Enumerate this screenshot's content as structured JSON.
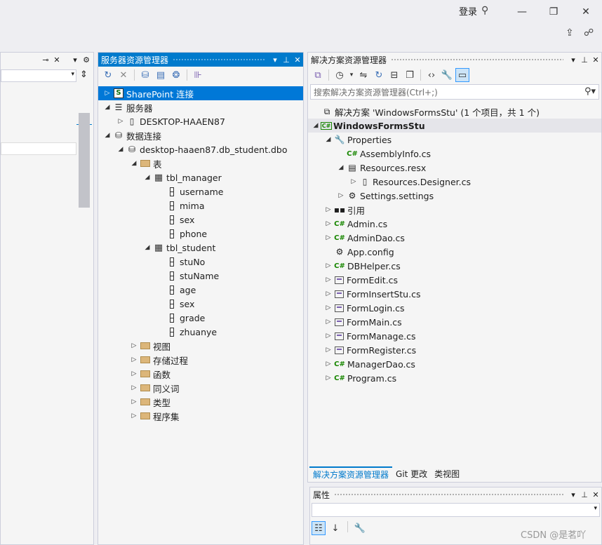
{
  "titlebar": {
    "login": "登录"
  },
  "server_explorer": {
    "title": "服务器资源管理器",
    "tree": [
      {
        "label": "SharePoint 连接",
        "indent": 0,
        "arrow": "▷",
        "icon": "sharepoint-icon",
        "glyph": "S",
        "selected": true
      },
      {
        "label": "服务器",
        "indent": 0,
        "arrow": "◢",
        "icon": "servers-icon",
        "glyph": "☰"
      },
      {
        "label": "DESKTOP-HAAEN87",
        "indent": 1,
        "arrow": "▷",
        "icon": "server-icon",
        "glyph": "▯"
      },
      {
        "label": "数据连接",
        "indent": 0,
        "arrow": "◢",
        "icon": "data-connections-icon",
        "glyph": "⛁"
      },
      {
        "label": "desktop-haaen87.db_student.dbo",
        "indent": 1,
        "arrow": "◢",
        "icon": "database-icon",
        "glyph": "⛁"
      },
      {
        "label": "表",
        "indent": 2,
        "arrow": "◢",
        "icon": "folder-icon",
        "glyph": ""
      },
      {
        "label": "tbl_manager",
        "indent": 3,
        "arrow": "◢",
        "icon": "table-icon",
        "glyph": "▦"
      },
      {
        "label": "username",
        "indent": 4,
        "arrow": "",
        "icon": "column-icon",
        "glyph": ""
      },
      {
        "label": "mima",
        "indent": 4,
        "arrow": "",
        "icon": "column-icon",
        "glyph": ""
      },
      {
        "label": "sex",
        "indent": 4,
        "arrow": "",
        "icon": "column-icon",
        "glyph": ""
      },
      {
        "label": "phone",
        "indent": 4,
        "arrow": "",
        "icon": "column-icon",
        "glyph": ""
      },
      {
        "label": "tbl_student",
        "indent": 3,
        "arrow": "◢",
        "icon": "table-icon",
        "glyph": "▦"
      },
      {
        "label": "stuNo",
        "indent": 4,
        "arrow": "",
        "icon": "column-icon",
        "glyph": ""
      },
      {
        "label": "stuName",
        "indent": 4,
        "arrow": "",
        "icon": "column-icon",
        "glyph": ""
      },
      {
        "label": "age",
        "indent": 4,
        "arrow": "",
        "icon": "column-icon",
        "glyph": ""
      },
      {
        "label": "sex",
        "indent": 4,
        "arrow": "",
        "icon": "column-icon",
        "glyph": ""
      },
      {
        "label": "grade",
        "indent": 4,
        "arrow": "",
        "icon": "column-icon",
        "glyph": ""
      },
      {
        "label": "zhuanye",
        "indent": 4,
        "arrow": "",
        "icon": "column-icon",
        "glyph": ""
      },
      {
        "label": "视图",
        "indent": 2,
        "arrow": "▷",
        "icon": "folder-icon",
        "glyph": ""
      },
      {
        "label": "存储过程",
        "indent": 2,
        "arrow": "▷",
        "icon": "folder-icon",
        "glyph": ""
      },
      {
        "label": "函数",
        "indent": 2,
        "arrow": "▷",
        "icon": "folder-icon",
        "glyph": ""
      },
      {
        "label": "同义词",
        "indent": 2,
        "arrow": "▷",
        "icon": "folder-icon",
        "glyph": ""
      },
      {
        "label": "类型",
        "indent": 2,
        "arrow": "▷",
        "icon": "folder-icon",
        "glyph": ""
      },
      {
        "label": "程序集",
        "indent": 2,
        "arrow": "▷",
        "icon": "folder-icon",
        "glyph": ""
      }
    ]
  },
  "solution_explorer": {
    "title": "解决方案资源管理器",
    "search_placeholder": "搜索解决方案资源管理器(Ctrl+;)",
    "tree": [
      {
        "label": "解决方案 'WindowsFormsStu' (1 个项目，共 1 个)",
        "indent": 0,
        "arrow": "",
        "icon": "solution-icon",
        "glyph": "⧉"
      },
      {
        "label": "WindowsFormsStu",
        "indent": 0,
        "arrow": "◢",
        "icon": "csharp-project-icon",
        "glyph": "C#",
        "bold": true,
        "highlight": true
      },
      {
        "label": "Properties",
        "indent": 1,
        "arrow": "◢",
        "icon": "wrench-icon",
        "glyph": "🔧"
      },
      {
        "label": "AssemblyInfo.cs",
        "indent": 2,
        "arrow": "",
        "icon": "csharp-file-icon",
        "glyph": "C#"
      },
      {
        "label": "Resources.resx",
        "indent": 2,
        "arrow": "◢",
        "icon": "resx-icon",
        "glyph": "▤"
      },
      {
        "label": "Resources.Designer.cs",
        "indent": 3,
        "arrow": "▷",
        "icon": "designer-file-icon",
        "glyph": "▯"
      },
      {
        "label": "Settings.settings",
        "indent": 2,
        "arrow": "▷",
        "icon": "settings-icon",
        "glyph": "⚙"
      },
      {
        "label": "引用",
        "indent": 1,
        "arrow": "▷",
        "icon": "references-icon",
        "glyph": "▪▪"
      },
      {
        "label": "Admin.cs",
        "indent": 1,
        "arrow": "▷",
        "icon": "csharp-file-icon",
        "glyph": "C#"
      },
      {
        "label": "AdminDao.cs",
        "indent": 1,
        "arrow": "▷",
        "icon": "csharp-file-icon",
        "glyph": "C#"
      },
      {
        "label": "App.config",
        "indent": 1,
        "arrow": "",
        "icon": "config-icon",
        "glyph": "⚙"
      },
      {
        "label": "DBHelper.cs",
        "indent": 1,
        "arrow": "▷",
        "icon": "csharp-file-icon",
        "glyph": "C#"
      },
      {
        "label": "FormEdit.cs",
        "indent": 1,
        "arrow": "▷",
        "icon": "form-icon",
        "glyph": ""
      },
      {
        "label": "FormInsertStu.cs",
        "indent": 1,
        "arrow": "▷",
        "icon": "form-icon",
        "glyph": ""
      },
      {
        "label": "FormLogin.cs",
        "indent": 1,
        "arrow": "▷",
        "icon": "form-icon",
        "glyph": ""
      },
      {
        "label": "FormMain.cs",
        "indent": 1,
        "arrow": "▷",
        "icon": "form-icon",
        "glyph": ""
      },
      {
        "label": "FormManage.cs",
        "indent": 1,
        "arrow": "▷",
        "icon": "form-icon",
        "glyph": ""
      },
      {
        "label": "FormRegister.cs",
        "indent": 1,
        "arrow": "▷",
        "icon": "form-icon",
        "glyph": ""
      },
      {
        "label": "ManagerDao.cs",
        "indent": 1,
        "arrow": "▷",
        "icon": "csharp-file-icon",
        "glyph": "C#"
      },
      {
        "label": "Program.cs",
        "indent": 1,
        "arrow": "▷",
        "icon": "csharp-file-icon",
        "glyph": "C#"
      }
    ],
    "tabs": [
      {
        "label": "解决方案资源管理器",
        "active": true
      },
      {
        "label": "Git 更改",
        "active": false
      },
      {
        "label": "类视图",
        "active": false
      }
    ]
  },
  "properties": {
    "title": "属性"
  },
  "watermark": "CSDN @是茗吖"
}
